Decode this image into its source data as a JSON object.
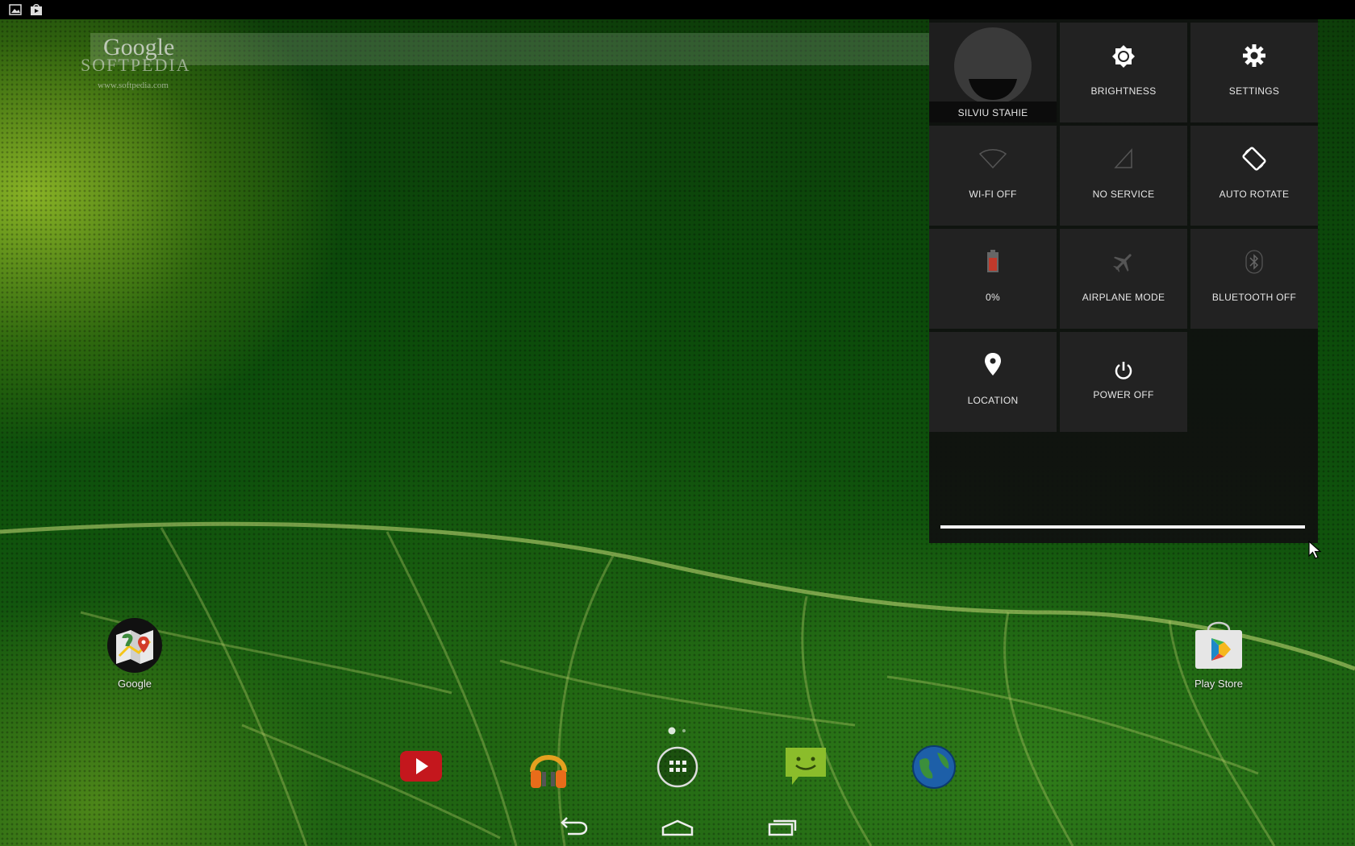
{
  "search": {
    "logo_text": "Google"
  },
  "watermark": {
    "name": "SOFTPEDIA",
    "url": "www.softpedia.com"
  },
  "quick_settings": {
    "user_name": "SILVIU STAHIE",
    "tiles": {
      "brightness": "BRIGHTNESS",
      "settings": "SETTINGS",
      "wifi": "WI-FI OFF",
      "signal": "NO SERVICE",
      "rotate": "AUTO ROTATE",
      "battery": "0%",
      "airplane": "AIRPLANE MODE",
      "bluetooth": "BLUETOOTH OFF",
      "location": "LOCATION",
      "power": "POWER OFF"
    }
  },
  "home": {
    "apps": {
      "google": "Google",
      "play_store": "Play Store"
    },
    "dock": [
      "youtube-icon",
      "music-icon",
      "all-apps-icon",
      "messaging-icon",
      "browser-icon"
    ],
    "current_page": 1,
    "page_count": 2
  },
  "navigation": [
    "back-icon",
    "home-icon",
    "recents-icon"
  ],
  "colors": {
    "accent_white": "#f2f2f2",
    "tile_bg": "#222222",
    "panel_bg": "#101010",
    "battery_red": "#c0392b"
  }
}
